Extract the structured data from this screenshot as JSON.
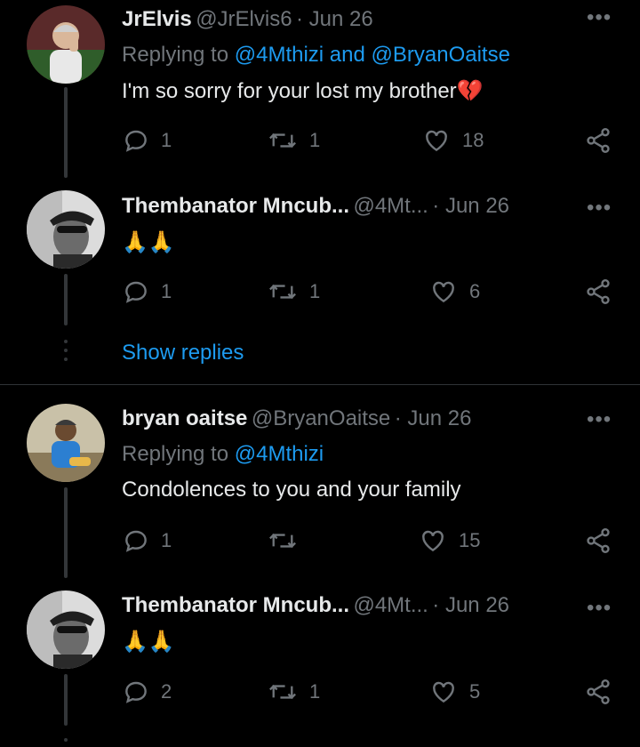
{
  "tweets": [
    {
      "name": "JrElvis",
      "handle": "@JrElvis6",
      "date": "· Jun 26",
      "replying_prefix": "Replying to ",
      "replying_to": "@4Mthizi and @BryanOaitse",
      "text": "I'm so sorry for your lost my brother💔",
      "replies": "1",
      "retweets": "1",
      "likes": "18"
    },
    {
      "name": "Thembanator Mncub...",
      "handle": "@4Mt...",
      "date": "· Jun 26",
      "text": "🙏🙏",
      "replies": "1",
      "retweets": "1",
      "likes": "6"
    },
    {
      "name": "bryan oaitse",
      "handle": "@BryanOaitse",
      "date": "· Jun 26",
      "replying_prefix": "Replying to ",
      "replying_to": "@4Mthizi",
      "text": "Condolences to you and your family",
      "replies": "1",
      "retweets": "",
      "likes": "15"
    },
    {
      "name": "Thembanator Mncub...",
      "handle": "@4Mt...",
      "date": "· Jun 26",
      "text": "🙏🙏",
      "replies": "2",
      "retweets": "1",
      "likes": "5"
    }
  ],
  "show_replies": "Show replies",
  "more_glyph": "•••",
  "icons": {
    "reply": "reply-icon",
    "retweet": "retweet-icon",
    "like": "heart-icon",
    "share": "share-icon",
    "more": "more-icon"
  },
  "colors": {
    "background": "#000000",
    "text": "#e7e9ea",
    "muted": "#71767b",
    "link": "#1d9bf0",
    "divider": "#2f3336"
  }
}
